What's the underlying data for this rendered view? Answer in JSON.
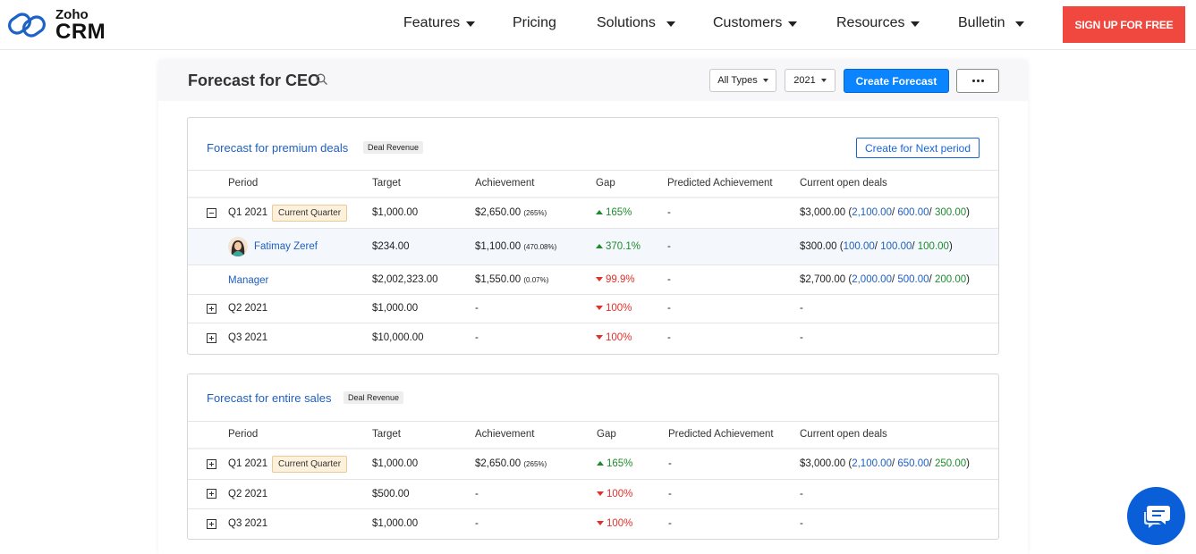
{
  "brand": {
    "small": "Zoho",
    "big": "CRM"
  },
  "nav": {
    "items": [
      {
        "label": "Features",
        "dropdown": true
      },
      {
        "label": "Pricing",
        "dropdown": false
      },
      {
        "label": "Solutions",
        "dropdown": true
      },
      {
        "label": "Customers",
        "dropdown": true
      },
      {
        "label": "Resources",
        "dropdown": true
      },
      {
        "label": "Bulletin",
        "dropdown": true
      }
    ],
    "signup_label": "SIGN UP FOR FREE"
  },
  "header": {
    "title": "Forecast for CEO",
    "type_filter": "All Types",
    "year_filter": "2021",
    "create_label": "Create Forecast"
  },
  "columns": [
    "Period",
    "Target",
    "Achievement",
    "Gap",
    "Predicted Achievement",
    "Current open deals"
  ],
  "cards": [
    {
      "title": "Forecast for premium deals",
      "tag": "Deal Revenue",
      "action_label": "Create for Next period",
      "rows": [
        {
          "period": "Q1 2021",
          "badge": "Current Quarter",
          "target": "$1,000.00",
          "ach": "$2,650.00",
          "ach_pct": "(265%)",
          "gap": "165%",
          "pred": "-",
          "open": "$3,000.00",
          "o1": "2,100.00",
          "o2": "600.00",
          "o3": "300.00"
        },
        {
          "period": "Fatimay Zeref",
          "target": "$234.00",
          "ach": "$1,100.00",
          "ach_pct": "(470.08%)",
          "gap": "370.1%",
          "pred": "-",
          "open": "$300.00",
          "o1": "100.00",
          "o2": "100.00",
          "o3": "100.00"
        },
        {
          "period": "Manager",
          "target": "$2,002,323.00",
          "ach": "$1,550.00",
          "ach_pct": "(0.07%)",
          "gap": "99.9%",
          "pred": "-",
          "open": "$2,700.00",
          "o1": "2,000.00",
          "o2": "500.00",
          "o3": "200.00"
        },
        {
          "period": "Q2 2021",
          "target": "$1,000.00",
          "ach": "-",
          "gap": "100%",
          "pred": "-",
          "open": "-"
        },
        {
          "period": "Q3 2021",
          "target": "$10,000.00",
          "ach": "-",
          "gap": "100%",
          "pred": "-",
          "open": "-"
        }
      ]
    },
    {
      "title": "Forecast for entire sales",
      "tag": "Deal Revenue",
      "rows": [
        {
          "period": "Q1 2021",
          "badge": "Current Quarter",
          "target": "$1,000.00",
          "ach": "$2,650.00",
          "ach_pct": "(265%)",
          "gap": "165%",
          "pred": "-",
          "open": "$3,000.00",
          "o1": "2,100.00",
          "o2": "650.00",
          "o3": "250.00"
        },
        {
          "period": "Q2 2021",
          "target": "$500.00",
          "ach": "-",
          "gap": "100%",
          "pred": "-",
          "open": "-"
        },
        {
          "period": "Q3 2021",
          "target": "$1,000.00",
          "ach": "-",
          "gap": "100%",
          "pred": "-",
          "open": "-"
        }
      ]
    }
  ],
  "colors": {
    "accent": "#0a84ff",
    "signup": "#f0483e",
    "link": "#1f5fbf",
    "positive": "#1f8a2d",
    "negative": "#e0312b"
  },
  "icons": [
    "zoho-logo-icon",
    "search-icon",
    "chevron-down-icon",
    "more-icon",
    "expand-icon",
    "collapse-icon",
    "chat-icon"
  ]
}
